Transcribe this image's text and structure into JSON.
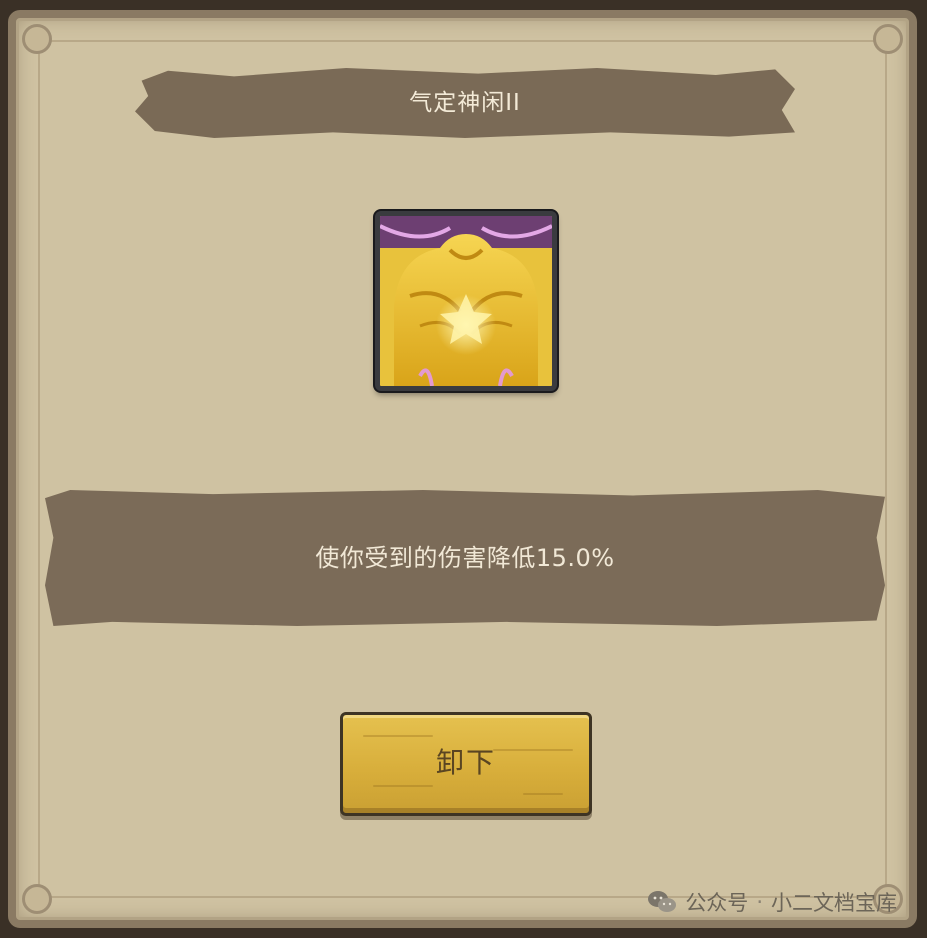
{
  "dialog": {
    "title": "气定神闲II",
    "skill_icon": "golden-muscular-torso-icon",
    "description": "使你受到的伤害降低15.0%",
    "unequip_label": "卸下"
  },
  "watermark": {
    "label": "公众号",
    "separator": "·",
    "account": "小二文档宝库",
    "icon": "wechat-icon"
  },
  "colors": {
    "panel": "#cfc2a2",
    "banner": "#7a6a56",
    "button": "#d7ad3a",
    "text_light": "#f3ead7"
  }
}
